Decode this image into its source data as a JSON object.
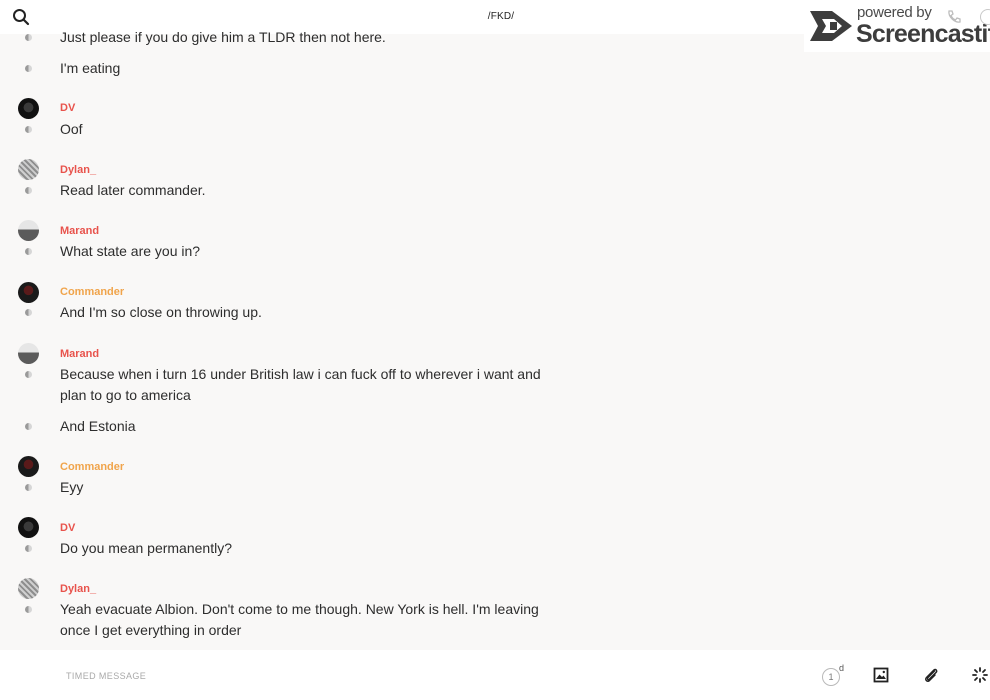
{
  "header": {
    "channel_name": "/FKD/",
    "search_icon": "search-icon"
  },
  "watermark": {
    "powered_by": "powered by",
    "brand": "Screencastify"
  },
  "colors": {
    "author_red": "#e8534c",
    "author_orange": "#f0a44b",
    "background": "#f9f8f7"
  },
  "messages": [
    {
      "text": "Just please if you do give him a TLDR then not here."
    },
    {
      "text": "I'm eating"
    },
    {
      "author": "DV",
      "text": "Oof"
    },
    {
      "author": "Dylan_",
      "text": "Read later commander."
    },
    {
      "author": "Marand",
      "text": "What state are you in?"
    },
    {
      "author": "Commander",
      "text": "And I'm so close on throwing up."
    },
    {
      "author": "Marand",
      "text": "Because when i turn 16 under British law i can fuck off to wherever i want and plan to go to america"
    },
    {
      "text": "And Estonia"
    },
    {
      "author": "Commander",
      "text": "Eyy"
    },
    {
      "author": "DV",
      "text": "Do you mean permanently?"
    },
    {
      "author": "Dylan_",
      "text": "Yeah evacuate Albion. Don't come to me though. New York is hell. I'm leaving once I get everything in order"
    }
  ],
  "composer": {
    "placeholder": "TIMED MESSAGE",
    "timer_value": "1",
    "timer_unit": "d"
  }
}
